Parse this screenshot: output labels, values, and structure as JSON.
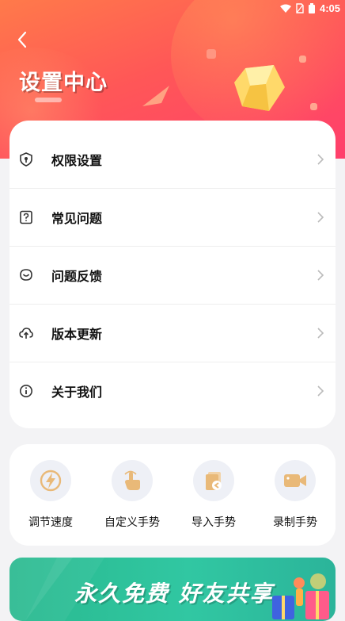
{
  "status": {
    "time": "4:05"
  },
  "header": {
    "title": "设置中心"
  },
  "menu": [
    {
      "label": "权限设置",
      "icon": "shield-icon"
    },
    {
      "label": "常见问题",
      "icon": "question-icon"
    },
    {
      "label": "问题反馈",
      "icon": "feedback-icon"
    },
    {
      "label": "版本更新",
      "icon": "cloud-upload-icon"
    },
    {
      "label": "关于我们",
      "icon": "info-icon"
    }
  ],
  "tools": [
    {
      "label": "调节速度",
      "icon": "lightning-icon"
    },
    {
      "label": "自定义手势",
      "icon": "tap-hand-icon"
    },
    {
      "label": "导入手势",
      "icon": "import-icon"
    },
    {
      "label": "录制手势",
      "icon": "video-icon"
    }
  ],
  "banner": {
    "text": "永久免费 好友共享"
  },
  "colors": {
    "accent": "#ff5757",
    "icon_tan": "#e9b978",
    "banner_green": "#2fc09c"
  }
}
